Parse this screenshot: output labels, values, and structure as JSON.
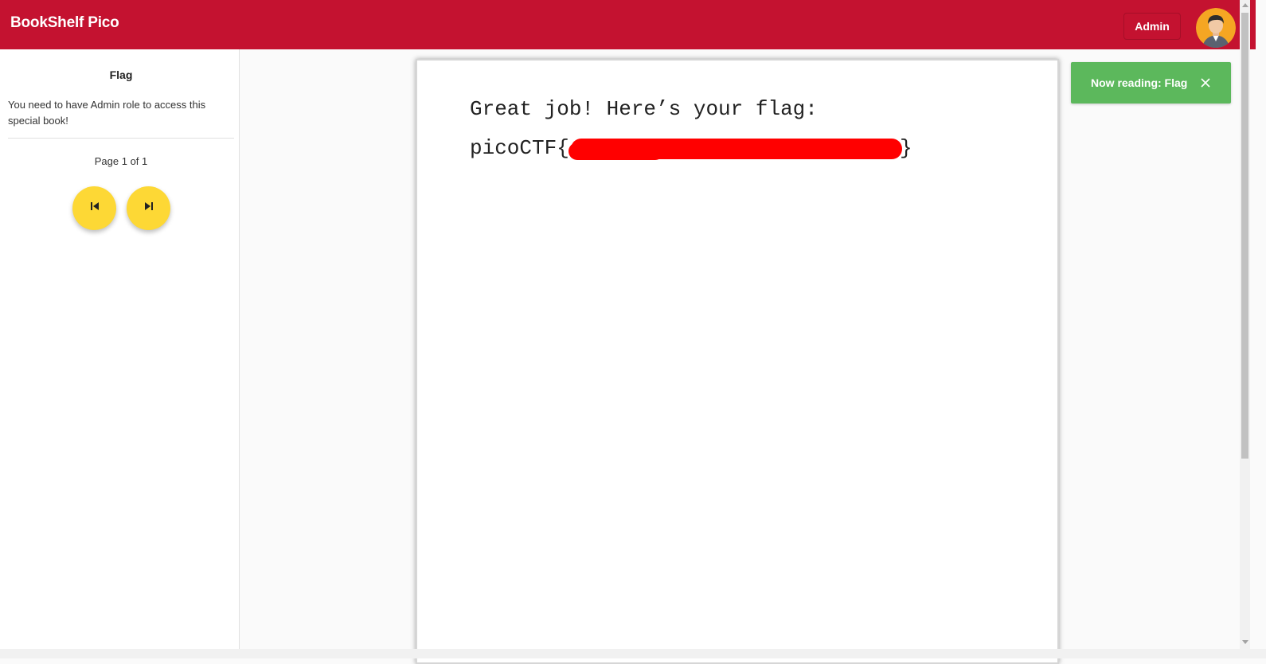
{
  "header": {
    "app_title": "BookShelf Pico",
    "admin_label": "Admin",
    "avatar_icon": "user-avatar-icon",
    "brand_color": "#c41230"
  },
  "sidebar": {
    "book_title": "Flag",
    "book_description": "You need to have Admin role to access this special book!",
    "page_indicator": "Page 1 of 1",
    "prev_icon": "skip-previous-icon",
    "next_icon": "skip-next-icon",
    "button_color": "#fdd835"
  },
  "book_page": {
    "line1": "Great job! Here’s your flag:",
    "line2_prefix": "picoCTF{",
    "line2_suffix": "}"
  },
  "toast": {
    "message": "Now reading: Flag",
    "close_icon": "close-icon",
    "color": "#5cb85c"
  }
}
